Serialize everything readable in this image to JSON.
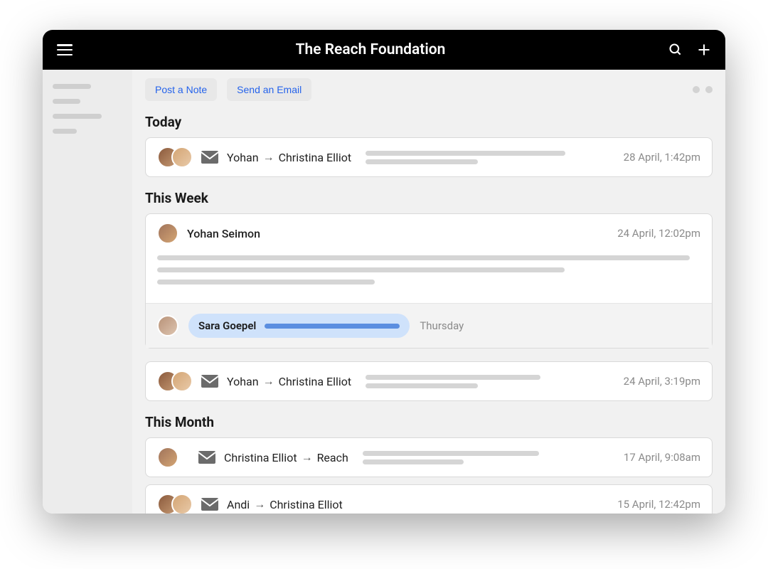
{
  "header": {
    "title": "The Reach Foundation"
  },
  "toolbar": {
    "post_note": "Post a Note",
    "send_email": "Send an Email"
  },
  "sections": {
    "today": "Today",
    "this_week": "This Week",
    "this_month": "This Month"
  },
  "entries": {
    "today1": {
      "from": "Yohan",
      "to": "Christina Elliot",
      "ts": "28 April, 1:42pm"
    },
    "week_note": {
      "author": "Yohan Seimon",
      "ts": "24 April, 12:02pm"
    },
    "week_reply": {
      "author": "Sara Goepel",
      "ts": "Thursday"
    },
    "week_email": {
      "from": "Yohan",
      "to": "Christina Elliot",
      "ts": "24 April, 3:19pm"
    },
    "month1": {
      "from": "Christina Elliot",
      "to": "Reach",
      "ts": "17 April, 9:08am"
    },
    "month2": {
      "from": "Andi",
      "to": "Christina Elliot",
      "ts": "15 April, 12:42pm"
    }
  }
}
